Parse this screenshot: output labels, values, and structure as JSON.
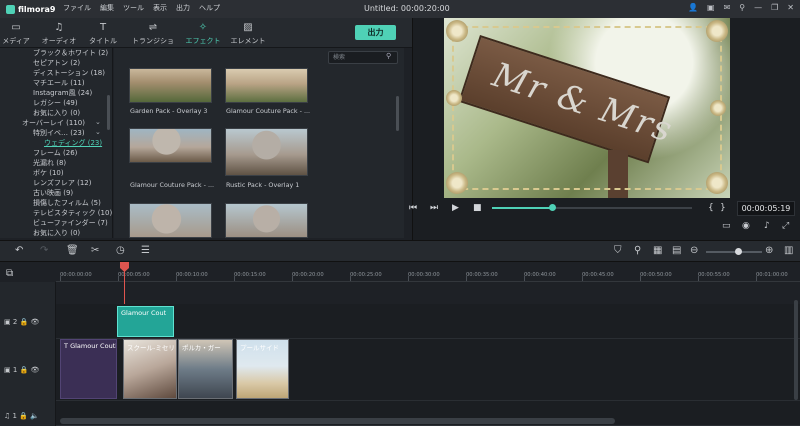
{
  "app": {
    "logo_text": "filmora9",
    "document_title": "Untitled:",
    "document_time": "00:00:20:00"
  },
  "menu": [
    "ファイル",
    "編集",
    "ツール",
    "表示",
    "出力",
    "ヘルプ"
  ],
  "tabs": [
    {
      "label": "メディア",
      "icon": "folder-icon"
    },
    {
      "label": "オーディオ",
      "icon": "music-note-icon"
    },
    {
      "label": "タイトル",
      "icon": "text-t-icon"
    },
    {
      "label": "トランジション",
      "icon": "transition-icon"
    },
    {
      "label": "エフェクト",
      "icon": "sparkle-icon",
      "active": true
    },
    {
      "label": "エレメント",
      "icon": "image-icon"
    }
  ],
  "export_label": "出力",
  "search": {
    "placeholder": "検索"
  },
  "categories": [
    "ブラック＆ホワイト (2)",
    "セピアトン (2)",
    "ディストーション (18)",
    "マチエール (11)",
    "Instagram風 (24)",
    "レガシー (49)",
    "お気に入り (0)",
    "オーバーレイ (110)",
    "特別イベ… (23)",
    "ウェディング (23)",
    "フレーム (26)",
    "光漏れ (8)",
    "ボケ (10)",
    "レンズフレア (12)",
    "古い映画 (9)",
    "損傷したフィルム (5)",
    "テレビスタティック (10)",
    "ビューファインダー (7)",
    "お気に入り (0)"
  ],
  "effects": [
    "Garden Pack - Overlay 3",
    "Glamour Couture Pack - ...",
    "Glamour Couture Pack - ...",
    "Rustic Pack - Overlay 1",
    "",
    ""
  ],
  "preview": {
    "sign_text": "Mr & Mrs",
    "timecode": "00:00:05:19",
    "progress": 0.3
  },
  "ruler": [
    "00:00:00:00",
    "00:00:05:00",
    "00:00:10:00",
    "00:00:15:00",
    "00:00:20:00",
    "00:00:25:00",
    "00:00:30:00",
    "00:00:35:00",
    "00:00:40:00",
    "00:00:45:00",
    "00:00:50:00",
    "00:00:55:00",
    "00:01:00:00"
  ],
  "tracks": {
    "overlay_num": "2",
    "video_num": "1",
    "audio_num": "1"
  },
  "clips": {
    "overlay": "Glamour Cout",
    "title": "Glamour Couti",
    "v1": "スクール-ミセリ",
    "v2": "ポルカ・ガー",
    "v3": "プールサイド"
  },
  "zoom": 0.58,
  "colors": {
    "accent": "#4fd1b6",
    "playhead": "#e0554f",
    "clip_overlay": "#23a597",
    "clip_title": "#3b2f55"
  }
}
